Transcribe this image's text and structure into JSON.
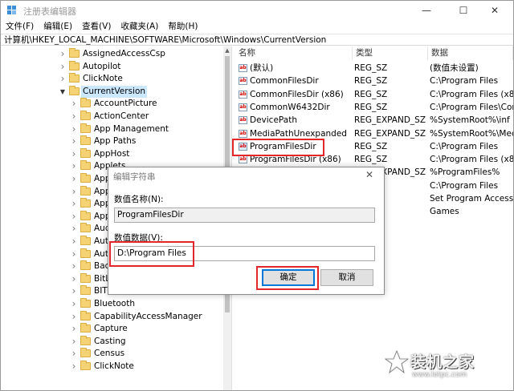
{
  "window": {
    "title": "注册表编辑器",
    "minimize": "—",
    "maximize": "☐",
    "close": "✕"
  },
  "menu": [
    "文件(F)",
    "编辑(E)",
    "查看(V)",
    "收藏夹(A)",
    "帮助(H)"
  ],
  "address": "计算机\\HKEY_LOCAL_MACHINE\\SOFTWARE\\Microsoft\\Windows\\CurrentVersion",
  "tree": [
    {
      "label": "AssignedAccessCsp",
      "level": 0,
      "expanded": false
    },
    {
      "label": "Autopilot",
      "level": 0,
      "expanded": false
    },
    {
      "label": "ClickNote",
      "level": 0,
      "expanded": false
    },
    {
      "label": "CurrentVersion",
      "level": 0,
      "expanded": true,
      "selected": true
    },
    {
      "label": "AccountPicture",
      "level": 1,
      "expanded": false
    },
    {
      "label": "ActionCenter",
      "level": 1,
      "expanded": false
    },
    {
      "label": "App Management",
      "level": 1,
      "expanded": false
    },
    {
      "label": "App Paths",
      "level": 1,
      "expanded": false
    },
    {
      "label": "AppHost",
      "level": 1,
      "expanded": false
    },
    {
      "label": "Applets",
      "level": 1,
      "expanded": false
    },
    {
      "label": "Appl",
      "level": 1,
      "expanded": false
    },
    {
      "label": "App",
      "level": 1,
      "expanded": false
    },
    {
      "label": "App",
      "level": 1,
      "expanded": false
    },
    {
      "label": "App",
      "level": 1,
      "expanded": false
    },
    {
      "label": "Aud",
      "level": 1,
      "expanded": false
    },
    {
      "label": "Auth",
      "level": 1,
      "expanded": false
    },
    {
      "label": "Auto",
      "level": 1,
      "expanded": false
    },
    {
      "label": "Back",
      "level": 1,
      "expanded": false
    },
    {
      "label": "BitL",
      "level": 1,
      "expanded": false
    },
    {
      "label": "BITS",
      "level": 1,
      "expanded": false
    },
    {
      "label": "Bluetooth",
      "level": 1,
      "expanded": false
    },
    {
      "label": "CapabilityAccessManager",
      "level": 1,
      "expanded": false
    },
    {
      "label": "Capture",
      "level": 1,
      "expanded": false
    },
    {
      "label": "Casting",
      "level": 1,
      "expanded": false
    },
    {
      "label": "Census",
      "level": 1,
      "expanded": false
    },
    {
      "label": "ClickNote",
      "level": 1,
      "expanded": false
    }
  ],
  "list": {
    "headers": [
      "名称",
      "类型",
      "数据"
    ],
    "rows": [
      {
        "name": "(默认)",
        "type": "REG_SZ",
        "data": "(数值未设置)"
      },
      {
        "name": "CommonFilesDir",
        "type": "REG_SZ",
        "data": "C:\\Program Files"
      },
      {
        "name": "CommonFilesDir (x86)",
        "type": "REG_SZ",
        "data": "C:\\Program Files (x86)"
      },
      {
        "name": "CommonW6432Dir",
        "type": "REG_SZ",
        "data": "C:\\Program Files\\Com"
      },
      {
        "name": "DevicePath",
        "type": "REG_EXPAND_SZ",
        "data": "%SystemRoot%\\inf"
      },
      {
        "name": "MediaPathUnexpanded",
        "type": "REG_EXPAND_SZ",
        "data": "%SystemRoot%\\Medi"
      },
      {
        "name": "ProgramFilesDir",
        "type": "REG_SZ",
        "data": "C:\\Program Files"
      },
      {
        "name": "ProgramFilesDir (x86)",
        "type": "REG_SZ",
        "data": "C:\\Program Files (x86)"
      },
      {
        "name": "",
        "type": "REG_EXPAND_SZ",
        "data": "%ProgramFiles%"
      },
      {
        "name": "",
        "type": "",
        "data": "C:\\Program Files"
      },
      {
        "name": "",
        "type": "",
        "data": "Set Program Access a"
      },
      {
        "name": "",
        "type": "",
        "data": "Games"
      }
    ]
  },
  "dialog": {
    "title": "编辑字符串",
    "close": "✕",
    "name_label": "数值名称(N):",
    "name_value": "ProgramFilesDir",
    "data_label": "数值数据(V):",
    "data_value": "D:\\Program Files",
    "ok": "确定",
    "cancel": "取消"
  },
  "watermark": {
    "title": "装机之家",
    "url": "www.lotpc.com"
  }
}
